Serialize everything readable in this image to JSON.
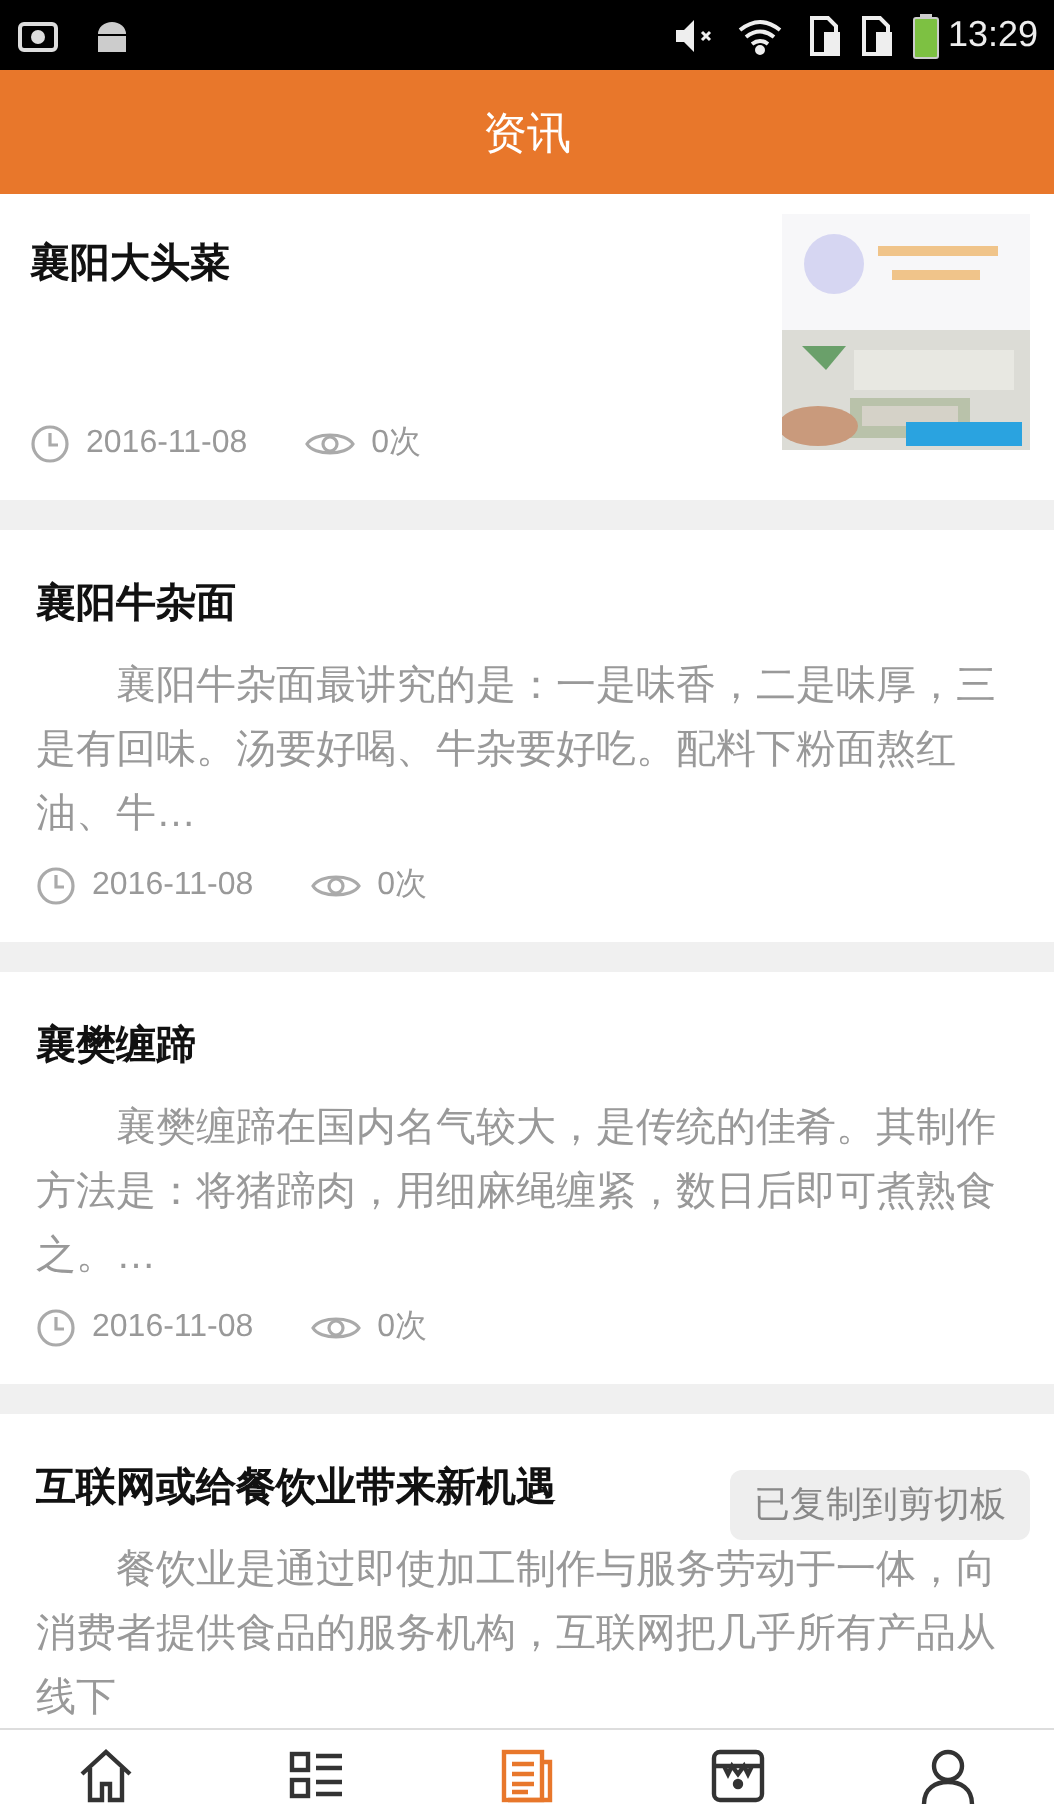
{
  "status_bar": {
    "time": "13:29"
  },
  "header": {
    "title": "资讯"
  },
  "articles": [
    {
      "kind": "thumb",
      "title": "襄阳大头菜",
      "date": "2016-11-08",
      "views": "0次"
    },
    {
      "kind": "text",
      "title": "襄阳牛杂面",
      "summary": "襄阳牛杂面最讲究的是：一是味香，二是味厚，三是有回味。汤要好喝、牛杂要好吃。配料下粉面熬红油、牛…",
      "date": "2016-11-08",
      "views": "0次"
    },
    {
      "kind": "text",
      "title": "襄樊缠蹄",
      "summary": "襄樊缠蹄在国内名气较大，是传统的佳肴。其制作方法是：将猪蹄肉，用细麻绳缠紧，数日后即可煮熟食之。…",
      "date": "2016-11-08",
      "views": "0次"
    },
    {
      "kind": "text",
      "title": "互联网或给餐饮业带来新机遇",
      "summary": "餐饮业是通过即使加工制作与服务劳动于一体，向消费者提供食品的服务机构，互联网把几乎所有产品从线下"
    }
  ],
  "toast": {
    "text": "已复制到剪切板"
  },
  "bottom_nav": [
    {
      "kind": "home",
      "selected": false
    },
    {
      "kind": "list",
      "selected": false
    },
    {
      "kind": "news",
      "selected": true
    },
    {
      "kind": "store",
      "selected": false
    },
    {
      "kind": "user",
      "selected": false
    }
  ]
}
